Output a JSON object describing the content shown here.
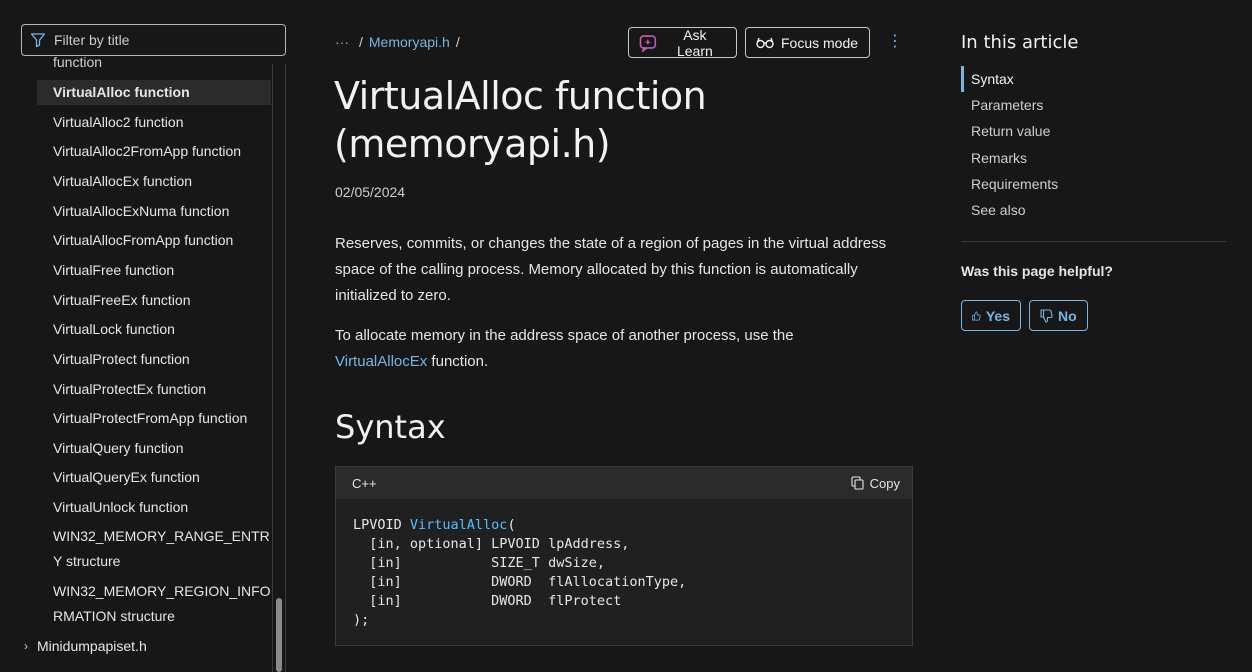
{
  "leftnav": {
    "filter_placeholder": "Filter by title",
    "items": [
      {
        "label": "function"
      },
      {
        "label": "VirtualAlloc function"
      },
      {
        "label": "VirtualAlloc2 function"
      },
      {
        "label": "VirtualAlloc2FromApp function"
      },
      {
        "label": "VirtualAllocEx function"
      },
      {
        "label": "VirtualAllocExNuma function"
      },
      {
        "label": "VirtualAllocFromApp function"
      },
      {
        "label": "VirtualFree function"
      },
      {
        "label": "VirtualFreeEx function"
      },
      {
        "label": "VirtualLock function"
      },
      {
        "label": "VirtualProtect function"
      },
      {
        "label": "VirtualProtectEx function"
      },
      {
        "label": "VirtualProtectFromApp function"
      },
      {
        "label": "VirtualQuery function"
      },
      {
        "label": "VirtualQueryEx function"
      },
      {
        "label": "VirtualUnlock function"
      },
      {
        "label": "WIN32_MEMORY_RANGE_ENTRY structure"
      },
      {
        "label": "WIN32_MEMORY_REGION_INFORMATION structure"
      },
      {
        "label": "Minidumpapiset.h"
      }
    ]
  },
  "header": {
    "breadcrumb_ellipsis": "···",
    "breadcrumb_sep": "/",
    "breadcrumb_link": "Memoryapi.h",
    "ask_learn": "Ask Learn",
    "focus_mode": "Focus mode",
    "more": "⋮"
  },
  "article": {
    "title": "VirtualAlloc function (memoryapi.h)",
    "date": "02/05/2024",
    "para1": "Reserves, commits, or changes the state of a region of pages in the virtual address space of the calling process. Memory allocated by this function is automatically initialized to zero.",
    "para2_prefix": "To allocate memory in the address space of another process, use the",
    "para2_link": "VirtualAllocEx",
    "para2_suffix": " function.",
    "syntax_heading": "Syntax",
    "code_lang": "C++",
    "copy_label": "Copy",
    "code_ret": "LPVOID ",
    "code_fn": "VirtualAlloc",
    "code_rest": "(\n  [in, optional] LPVOID lpAddress,\n  [in]           SIZE_T dwSize,\n  [in]           DWORD  flAllocationType,\n  [in]           DWORD  flProtect\n);"
  },
  "toc": {
    "title": "In this article",
    "items": [
      "Syntax",
      "Parameters",
      "Return value",
      "Remarks",
      "Requirements",
      "See also"
    ],
    "helpful": "Was this page helpful?",
    "yes": "Yes",
    "no": "No"
  },
  "colors": {
    "link": "#75b6e7",
    "background": "#171717",
    "code_function": "#4fc1ff"
  }
}
